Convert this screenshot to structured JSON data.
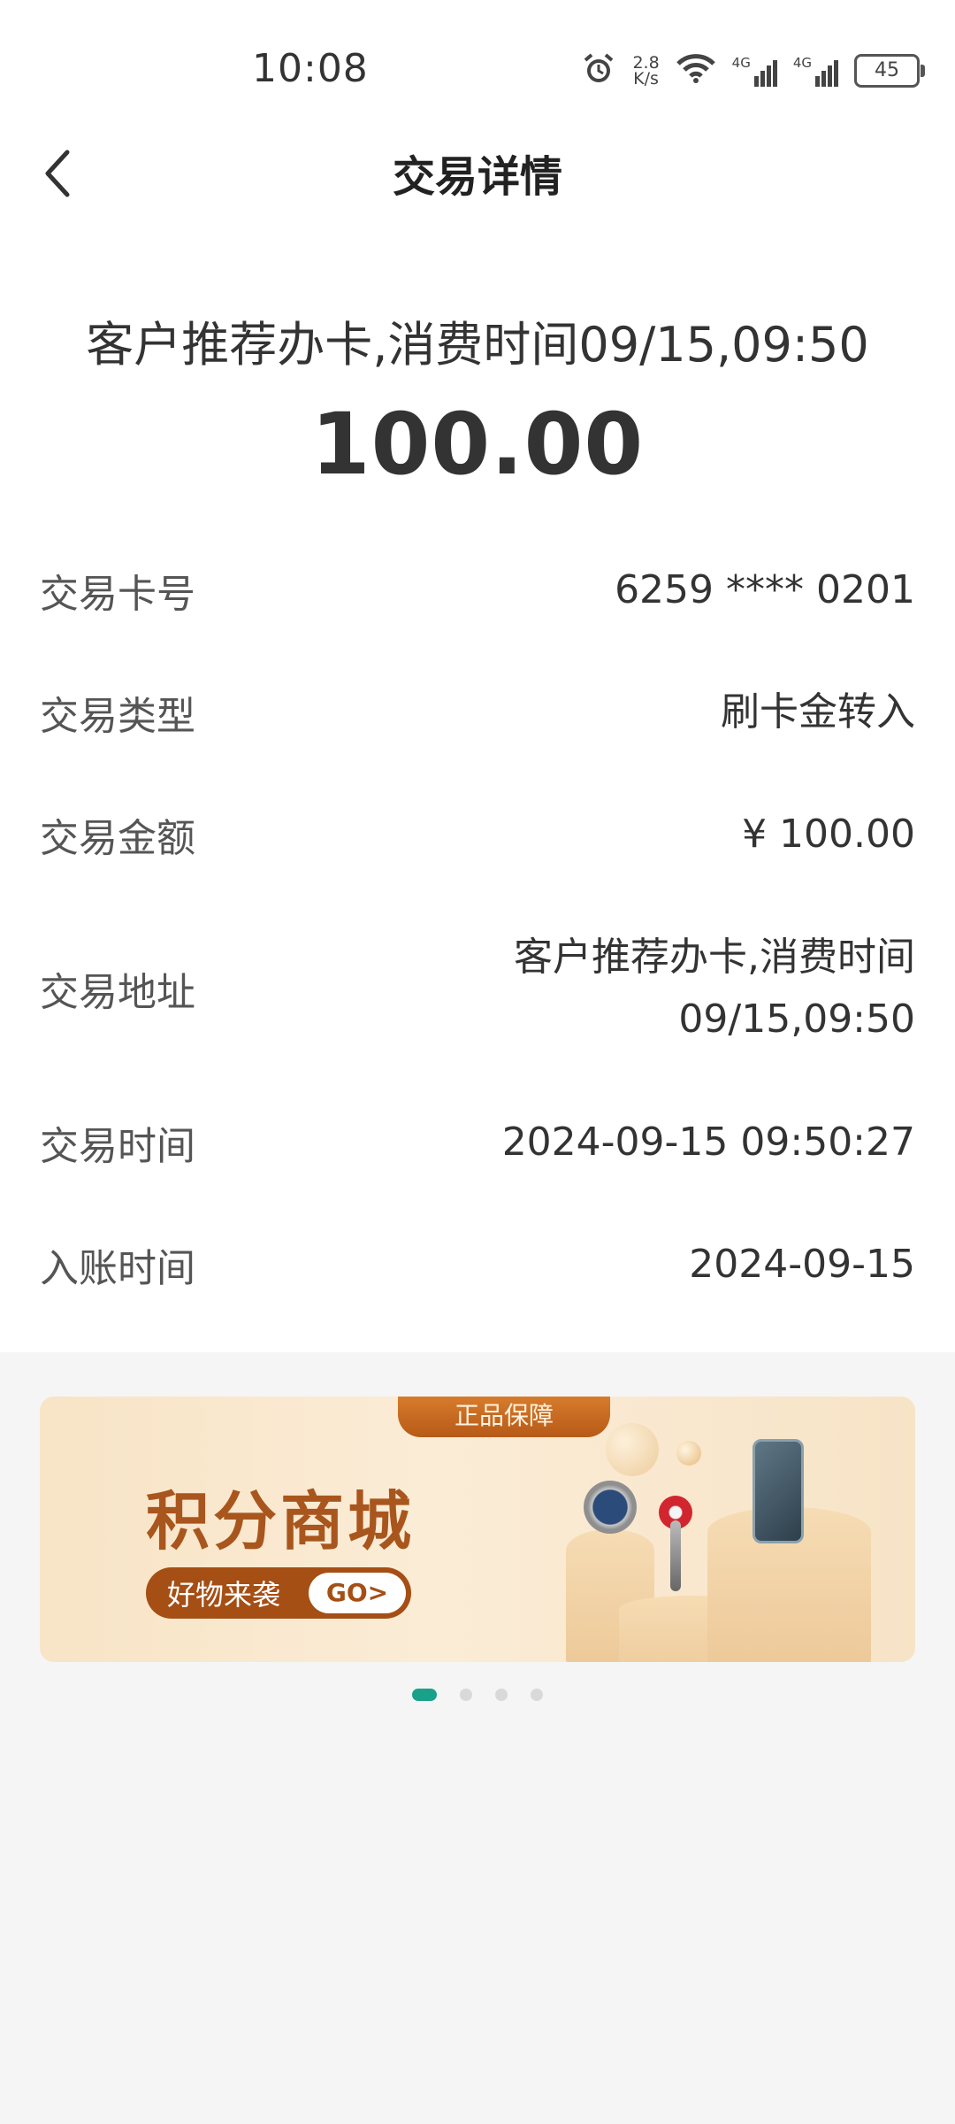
{
  "status_bar": {
    "time": "10:08",
    "net_speed_value": "2.8",
    "net_speed_unit": "K/s",
    "signal1_label": "4G",
    "signal2_label": "4G",
    "battery": "45",
    "icons": [
      "alarm-icon",
      "wifi-icon",
      "signal-icon",
      "battery-icon"
    ]
  },
  "nav": {
    "title": "交易详情",
    "back_icon": "chevron-left-icon"
  },
  "summary": {
    "description": "客户推荐办卡,消费时间09/15,09:50",
    "amount": "100.00"
  },
  "details": [
    {
      "label": "交易卡号",
      "value": "6259 **** 0201"
    },
    {
      "label": "交易类型",
      "value": "刷卡金转入"
    },
    {
      "label": "交易金额",
      "value": "¥ 100.00"
    },
    {
      "label": "交易地址",
      "value_line1": "客户推荐办卡,消费时间",
      "value_line2": "09/15,09:50"
    },
    {
      "label": "交易时间",
      "value": "2024-09-15 09:50:27"
    },
    {
      "label": "入账时间",
      "value": "2024-09-15"
    }
  ],
  "banner": {
    "tag": "正品保障",
    "title": "积分商城",
    "subtitle": "好物来袭",
    "go_label": "GO>",
    "page_count": 4,
    "active_index": 0
  },
  "colors": {
    "accent": "#1aa18a",
    "banner_brown": "#a54f15"
  }
}
